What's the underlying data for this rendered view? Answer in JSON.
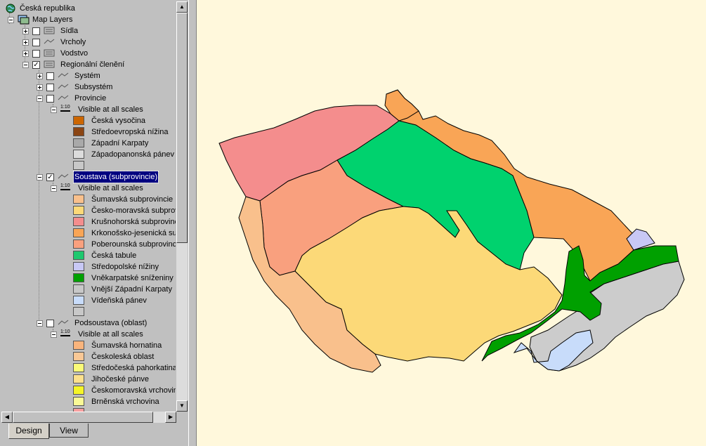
{
  "tree": {
    "root": {
      "label": "Česká republika",
      "icon": "globe-icon"
    },
    "map_layers": {
      "label": "Map Layers",
      "icon": "map-layers-icon"
    },
    "layers": [
      {
        "label": "Sídla",
        "checked": false,
        "expanded": false
      },
      {
        "label": "Vrcholy",
        "checked": false,
        "expanded": false
      },
      {
        "label": "Vodstvo",
        "checked": false,
        "expanded": false
      },
      {
        "label": "Regionální členění",
        "checked": true,
        "expanded": true
      }
    ],
    "sublayers": [
      {
        "label": "Systém",
        "checked": false,
        "expanded": false
      },
      {
        "label": "Subsystém",
        "checked": false,
        "expanded": false
      },
      {
        "label": "Provincie",
        "checked": false,
        "expanded": true
      }
    ],
    "scale_label": "Visible at all scales",
    "scale_icon_text": "1:10",
    "provincie_legend": [
      {
        "label": "Česká vysočina",
        "color": "#cc6600"
      },
      {
        "label": "Středoevropská nížina",
        "color": "#8b4513"
      },
      {
        "label": "Západní Karpaty",
        "color": "#a9a9a9"
      },
      {
        "label": "Západopanonská pánev",
        "color": "#dcdcdc"
      },
      {
        "label": "",
        "color": "#c8c8c8"
      }
    ],
    "soustava": {
      "label": "Soustava (subprovincie)",
      "checked": true,
      "selected": true
    },
    "soustava_legend": [
      {
        "label": "Šumavská subprovincie",
        "color": "#f9c08c"
      },
      {
        "label": "Česko-moravská subprov",
        "color": "#fcd978"
      },
      {
        "label": "Krušnohorská subprovinc",
        "color": "#f48d8d"
      },
      {
        "label": "Krkonošsko-jesenická sul",
        "color": "#f9a556"
      },
      {
        "label": "Poberounská subprovinci",
        "color": "#f9a07e"
      },
      {
        "label": "Česká tabule",
        "color": "#1ec86e"
      },
      {
        "label": "Středopolské nížiny",
        "color": "#c8c8f5"
      },
      {
        "label": "Vněkarpatské sníženiny",
        "color": "#00a000"
      },
      {
        "label": "Vnější Západní Karpaty",
        "color": "#c8c8c8"
      },
      {
        "label": "Vídeňská pánev",
        "color": "#c8dcfa"
      },
      {
        "label": "",
        "color": "#c8c8c8"
      }
    ],
    "podsoustava": {
      "label": "Podsoustava (oblast)",
      "checked": false
    },
    "podsoustava_legend": [
      {
        "label": "Šumavská hornatina",
        "color": "#f9b47c"
      },
      {
        "label": "Českoleská oblast",
        "color": "#f9c896"
      },
      {
        "label": "Středočeská pahorkatina",
        "color": "#fafa78"
      },
      {
        "label": "Jihočeské pánve",
        "color": "#fce08c"
      },
      {
        "label": "Českomoravská vrchovin",
        "color": "#f5f528"
      },
      {
        "label": "Brněnská vrchovina",
        "color": "#fafa96"
      },
      {
        "label": "",
        "color": "#f8a0a0"
      }
    ]
  },
  "tabs": [
    {
      "label": "Design",
      "active": true
    },
    {
      "label": "View",
      "active": false
    }
  ],
  "map": {
    "background": "#fff8dc",
    "regions": [
      {
        "name": "Šumavská subprovincie",
        "color": "#f9c08c"
      },
      {
        "name": "Česko-moravská subprovincie",
        "color": "#fcd978"
      },
      {
        "name": "Krušnohorská subprovincie",
        "color": "#f48d8d"
      },
      {
        "name": "Krkonošsko-jesenická subprovincie",
        "color": "#f9a556"
      },
      {
        "name": "Poberounská subprovincie",
        "color": "#f9a07e"
      },
      {
        "name": "Česká tabule",
        "color": "#00d26e"
      },
      {
        "name": "Středopolské nížiny",
        "color": "#c8c8f5"
      },
      {
        "name": "Vněkarpatské sníženiny",
        "color": "#00a000"
      },
      {
        "name": "Vnější Západní Karpaty",
        "color": "#cccccc"
      },
      {
        "name": "Vídeňská pánev",
        "color": "#c8dcfa"
      }
    ]
  }
}
